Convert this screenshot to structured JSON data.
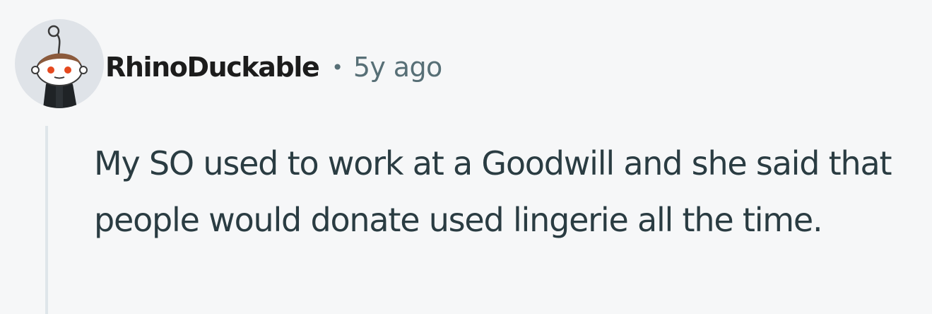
{
  "comment": {
    "author": "RhinoDuckable",
    "separator": "•",
    "timestamp": "5y ago",
    "body": "My SO used to work at a Goodwill and she said that people would donate used lingerie all the time."
  },
  "avatar": {
    "icon": "reddit-snoo-avatar",
    "background_color": "#dfe3e8"
  },
  "colors": {
    "page_background": "#f6f7f8",
    "username": "#1c1c1c",
    "meta": "#576f76",
    "body_text": "#2a3c42",
    "thread_line": "#dfe6ea"
  }
}
